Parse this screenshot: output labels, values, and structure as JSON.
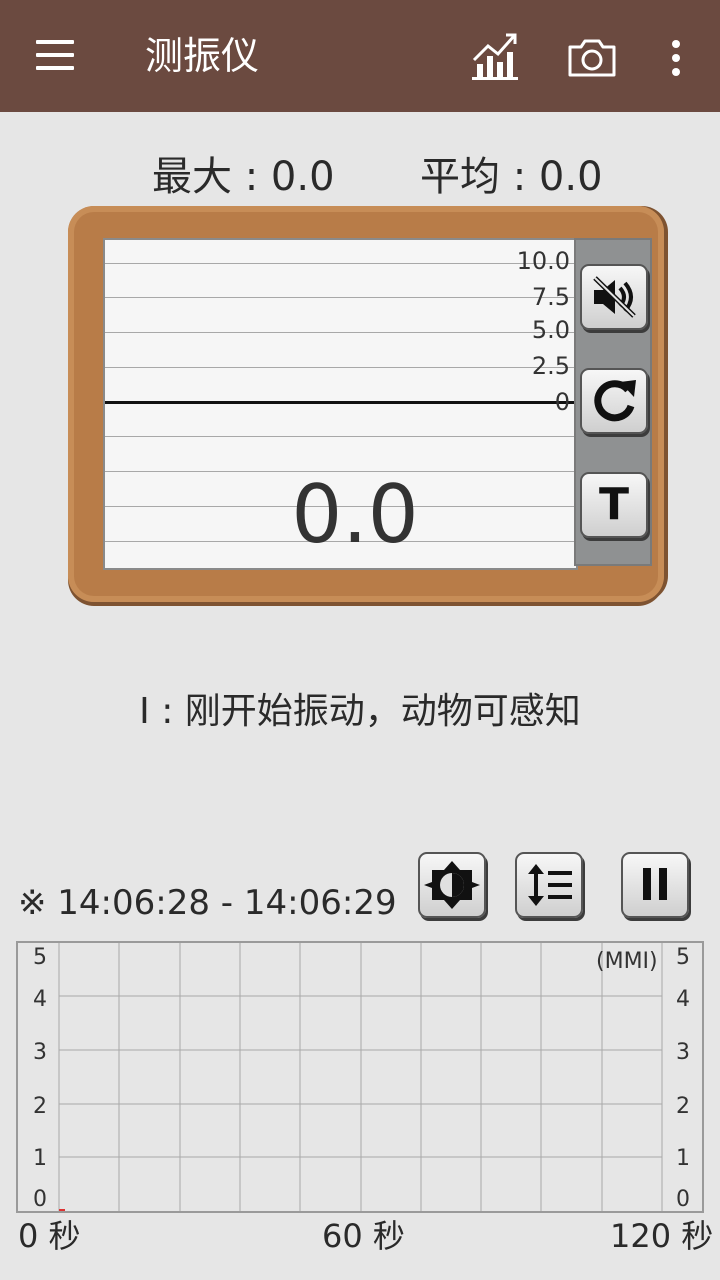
{
  "app": {
    "title": "测振仪",
    "icons": {
      "menu": "hamburger-menu-icon",
      "chart": "bar-chart-trend-icon",
      "camera": "camera-icon",
      "more": "more-vertical-icon"
    },
    "colors": {
      "appbar": "#6b4a40",
      "frame": "#b87c48",
      "background": "#e6e6e6"
    }
  },
  "stats": {
    "max": "最大 : 0.0",
    "avg": "平均 : 0.0"
  },
  "meter": {
    "scale_labels": [
      "10.0",
      "7.5",
      "5.0",
      "2.5",
      "0"
    ],
    "value": "0.0",
    "buttons": {
      "mute": "volume-off-icon",
      "reset": "refresh-icon",
      "text": "T"
    }
  },
  "level": {
    "text": "I : 刚开始振动，动物可感知"
  },
  "history": {
    "time_range": "※ 14:06:28 - 14:06:29",
    "controls": {
      "brightness": "brightness-icon",
      "sort": "line-spacing-icon",
      "pause": "pause-icon"
    },
    "unit": "(MMI)",
    "y_labels": [
      "5",
      "4",
      "3",
      "2",
      "1",
      "0"
    ],
    "x_labels": [
      "0 秒",
      "60 秒",
      "120 秒"
    ]
  }
}
